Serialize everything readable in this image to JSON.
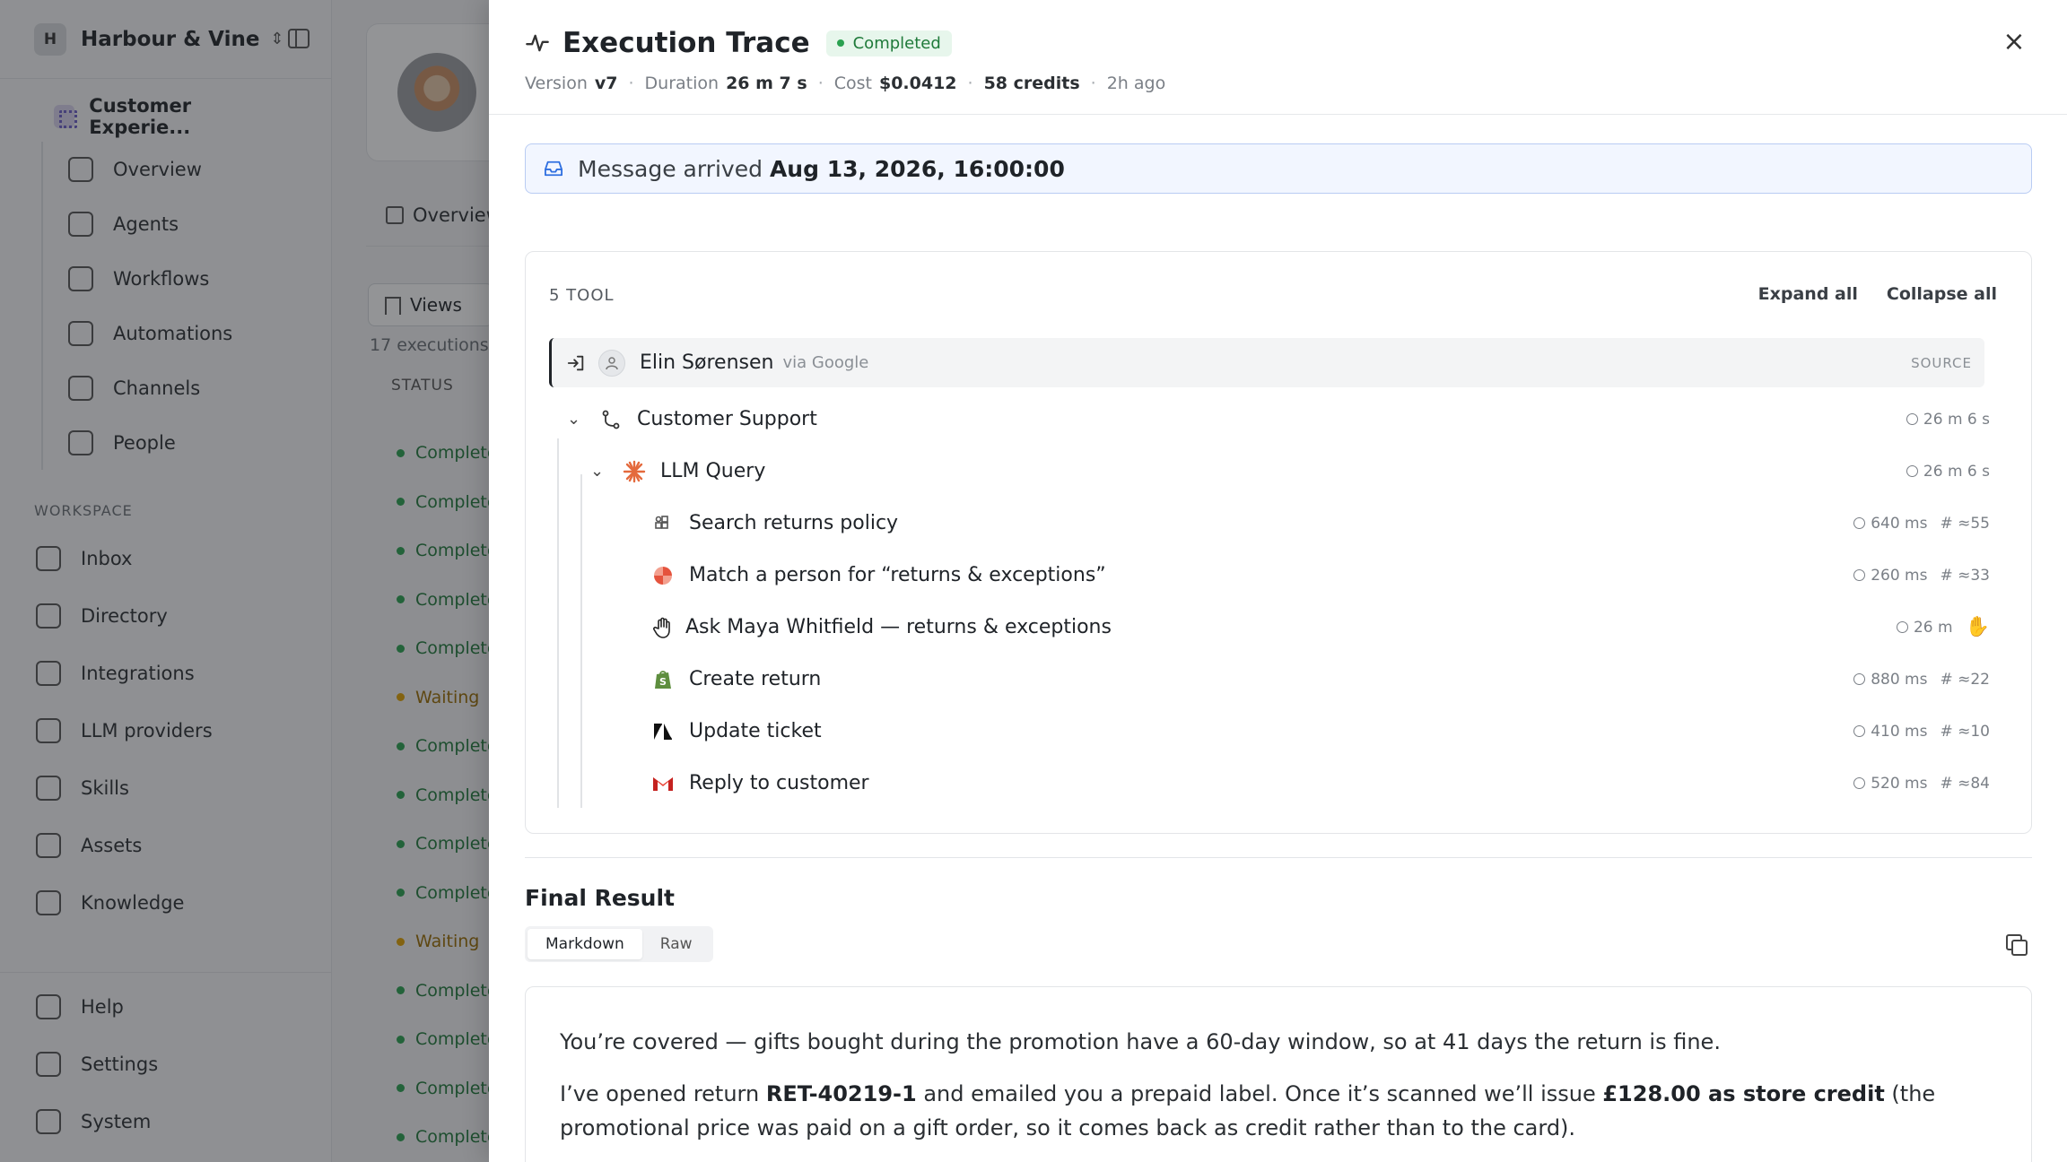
{
  "sidebar": {
    "workspace_initial": "H",
    "workspace_name": "Harbour & Vine",
    "project_name": "Customer Experie...",
    "project_items": [
      "Overview",
      "Agents",
      "Workflows",
      "Automations",
      "Channels",
      "People"
    ],
    "section_label": "WORKSPACE",
    "workspace_items": [
      "Inbox",
      "Directory",
      "Integrations",
      "LLM providers",
      "Skills",
      "Assets",
      "Knowledge"
    ],
    "footer_items": [
      "Help",
      "Settings",
      "System"
    ]
  },
  "background": {
    "tab_label": "Overview",
    "views_label": "Views",
    "executions_count": "17 executions",
    "status_header": "STATUS",
    "statuses": [
      "Completed",
      "Completed",
      "Completed",
      "Completed",
      "Completed",
      "Waiting",
      "Completed",
      "Completed",
      "Completed",
      "Completed",
      "Waiting",
      "Completed",
      "Completed",
      "Completed",
      "Completed"
    ]
  },
  "trace": {
    "title": "Execution Trace",
    "status": "Completed",
    "version_label": "Version",
    "version": "v7",
    "duration_label": "Duration",
    "duration": "26 m 7 s",
    "cost_label": "Cost",
    "cost": "$0.0412",
    "credits": "58 credits",
    "age": "2h ago",
    "arrived_label": "Message arrived",
    "arrived_time": "Aug 13, 2026, 16:00:00",
    "tool_count_label": "5 TOOL",
    "expand_all": "Expand all",
    "collapse_all": "Collapse all",
    "source": {
      "name": "Elin Sørensen",
      "via": "via Google",
      "tag": "SOURCE"
    },
    "nodes": {
      "workflow": {
        "label": "Customer Support",
        "time": "26 m 6 s"
      },
      "llm": {
        "label": "LLM Query",
        "time": "26 m 6 s"
      },
      "search": {
        "label": "Search returns policy",
        "time": "640 ms",
        "tokens": "# ≈55"
      },
      "match": {
        "label": "Match a person for “returns & exceptions”",
        "time": "260 ms",
        "tokens": "# ≈33"
      },
      "ask": {
        "label": "Ask Maya Whitfield — returns & exceptions",
        "time": "26 m"
      },
      "create": {
        "label": "Create return",
        "time": "880 ms",
        "tokens": "# ≈22"
      },
      "update": {
        "label": "Update ticket",
        "time": "410 ms",
        "tokens": "# ≈10"
      },
      "reply": {
        "label": "Reply to customer",
        "time": "520 ms",
        "tokens": "# ≈84"
      }
    }
  },
  "final_result": {
    "title": "Final Result",
    "tab_markdown": "Markdown",
    "tab_raw": "Raw",
    "p1": "You’re covered — gifts bought during the promotion have a 60-day window, so at 41 days the return is fine.",
    "p2_a": "I’ve opened return ",
    "p2_ref": "RET-40219-1",
    "p2_b": " and emailed you a prepaid label. Once it’s scanned we’ll issue ",
    "p2_amount": "£128.00 as store credit",
    "p2_c": " (the promotional price was paid on a gift order, so it comes back as credit rather than to the card)."
  },
  "colors": {
    "accent_blue": "#2f6fe0",
    "success_green": "#2aa150",
    "waiting_amber": "#e0a100",
    "shopify_green": "#5e8e3e",
    "gmail_red": "#ea4335",
    "llm_orange": "#e46a3d"
  },
  "icons": {
    "trace": "pulse-icon",
    "close": "close-icon",
    "arrived": "inbox-icon",
    "source": "enter-icon",
    "workflow": "branch-icon",
    "llm": "spark-icon",
    "search": "grid-search-icon",
    "match": "pinwheel-icon",
    "ask": "hand-icon",
    "create": "shopify-icon",
    "update": "zendesk-icon",
    "reply": "gmail-icon",
    "copy": "copy-icon"
  }
}
